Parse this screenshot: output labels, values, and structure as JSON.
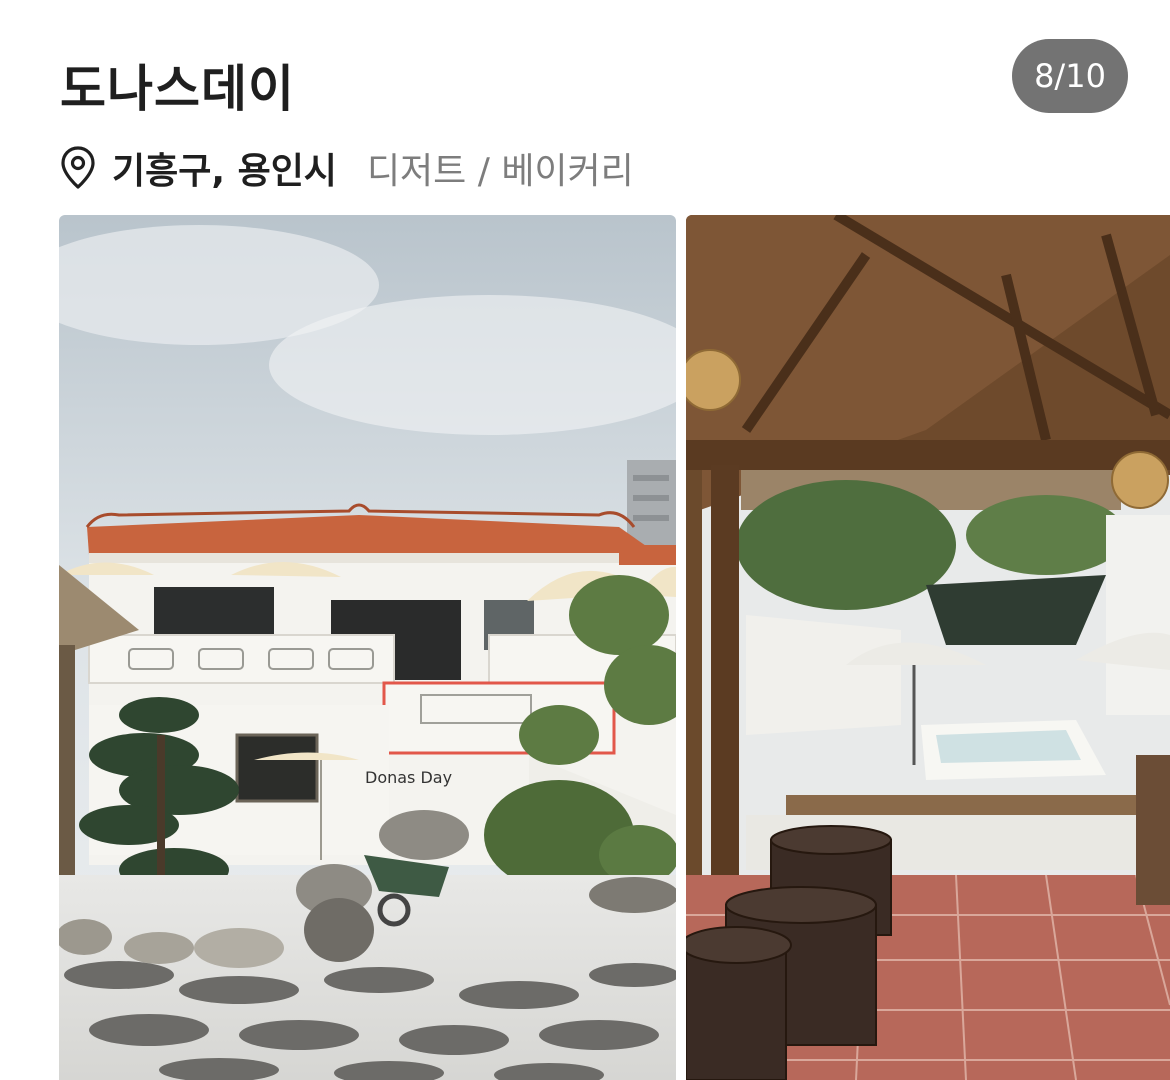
{
  "place": {
    "title": "도나스데이",
    "region": "기흥구, 용인시",
    "category": "디저트 / 베이커리"
  },
  "gallery": {
    "counter": "8/10",
    "photos": [
      {
        "name": "exterior",
        "sign_text": "Donas Day"
      },
      {
        "name": "patio"
      }
    ]
  },
  "icons": {
    "location": "map-pin-icon"
  },
  "colors": {
    "counter_bg": "#737373",
    "category_text": "#7d7d7d",
    "roof": "#c8643e"
  }
}
